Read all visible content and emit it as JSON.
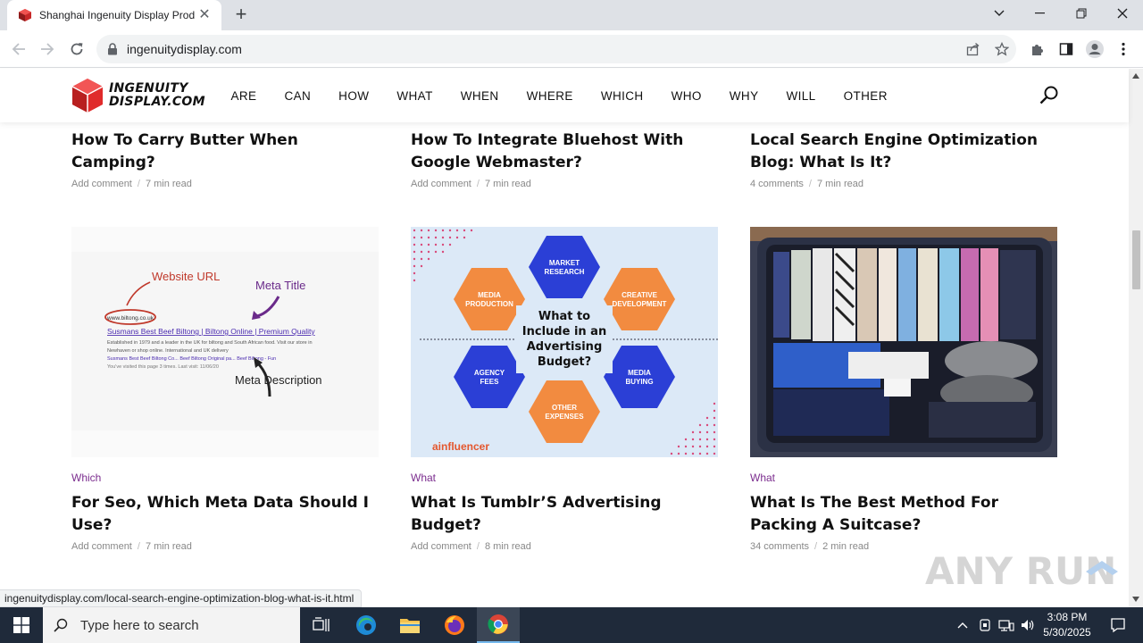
{
  "browser": {
    "tab_title": "Shanghai Ingenuity Display Prod",
    "url": "ingenuitydisplay.com",
    "status_url": "ingenuitydisplay.com/local-search-engine-optimization-blog-what-is-it.html"
  },
  "site": {
    "logo_line1": "INGENUITY",
    "logo_line2": "DISPLAY.COM",
    "nav": [
      "ARE",
      "CAN",
      "HOW",
      "WHAT",
      "WHEN",
      "WHERE",
      "WHICH",
      "WHO",
      "WHY",
      "WILL",
      "OTHER"
    ]
  },
  "posts_top": [
    {
      "title": "How To Carry Butter When Camping?",
      "comments": "Add comment",
      "read": "7 min read"
    },
    {
      "title": "How To Integrate Bluehost With Google Webmaster?",
      "comments": "Add comment",
      "read": "7 min read"
    },
    {
      "title": "Local Search Engine Optimization Blog: What Is It?",
      "comments": "4 comments",
      "read": "7 min read"
    }
  ],
  "posts_bottom": [
    {
      "category": "Which",
      "title": "For Seo, Which Meta Data Should I Use?",
      "comments": "Add comment",
      "read": "7 min read"
    },
    {
      "category": "What",
      "title": "What Is Tumblr’S Advertising Budget?",
      "comments": "Add comment",
      "read": "8 min read"
    },
    {
      "category": "What",
      "title": "What Is The Best Method For Packing A Suitcase?",
      "comments": "34 comments",
      "read": "2 min read"
    }
  ],
  "thumb_meta": {
    "website_url": "Website URL",
    "meta_title": "Meta Title",
    "meta_description": "Meta Description",
    "serp_url": "www.biltong.co.uk",
    "serp_title": "Susmans Best Beef Biltong | Biltong Online | Premium Quality",
    "serp_line1": "Established in 1979 and a leader in the UK for biltong and South African food. Visit our store in",
    "serp_line2": "Newhaven or shop online. International and UK delivery",
    "serp_line3": "Susmans Best Beef Biltong Co...  Beef Biltong Original pa...  Beef Biltong - Fun",
    "serp_line4": "You've visited this page 3 times. Last visit: 11/06/20"
  },
  "thumb_budget": {
    "center": [
      "What to",
      "Include in an",
      "Advertising",
      "Budget?"
    ],
    "hex_market": [
      "MARKET",
      "RESEARCH"
    ],
    "hex_media_prod": [
      "MEDIA",
      "PRODUCTION"
    ],
    "hex_creative": [
      "CREATIVE",
      "DEVELOPMENT"
    ],
    "hex_agency": [
      "AGENCY",
      "FEES"
    ],
    "hex_buying": [
      "MEDIA",
      "BUYING"
    ],
    "hex_other": [
      "OTHER",
      "EXPENSES"
    ],
    "brand": "ainfluencer"
  },
  "taskbar": {
    "search_placeholder": "Type here to search",
    "time": "3:08 PM",
    "date": "5/30/2025"
  },
  "watermark": "ANY RUN",
  "colors": {
    "category": "#7b2d8e",
    "hex_orange": "#f28b40",
    "hex_blue": "#2b3fd6",
    "budget_bg": "#dce9f7",
    "logo_red": "#e02b2b"
  }
}
